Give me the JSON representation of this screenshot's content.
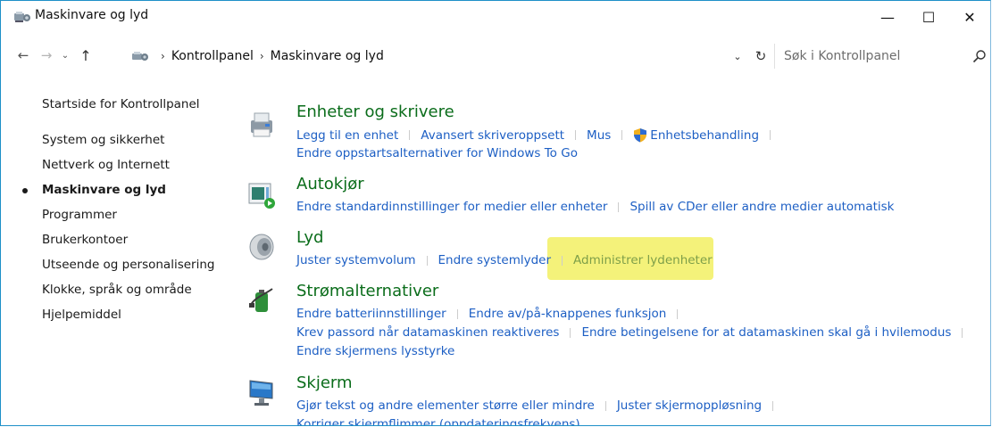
{
  "window": {
    "title": "Maskinvare og lyd",
    "minimize_glyph": "—",
    "maximize_glyph": "☐",
    "close_glyph": "✕"
  },
  "nav": {
    "back_glyph": "←",
    "forward_glyph": "→",
    "recent_glyph": "⌄",
    "up_glyph": "↑"
  },
  "address": {
    "breadcrumb": [
      "Kontrollpanel",
      "Maskinvare og lyd"
    ],
    "separator": "›",
    "dropdown_glyph": "⌄",
    "refresh_glyph": "↻"
  },
  "search": {
    "placeholder": "Søk i Kontrollpanel",
    "value": ""
  },
  "sidebar": {
    "items": [
      {
        "label": "Startside for Kontrollpanel",
        "current": false
      },
      {
        "label": "System og sikkerhet",
        "current": false
      },
      {
        "label": "Nettverk og Internett",
        "current": false
      },
      {
        "label": "Maskinvare og lyd",
        "current": true
      },
      {
        "label": "Programmer",
        "current": false
      },
      {
        "label": "Brukerkontoer",
        "current": false
      },
      {
        "label": "Utseende og personalisering",
        "current": false
      },
      {
        "label": "Klokke, språk og område",
        "current": false
      },
      {
        "label": "Hjelpemiddel",
        "current": false
      }
    ]
  },
  "categories": [
    {
      "title": "Enheter og skrivere",
      "icon": "printer-device-icon",
      "rows": [
        [
          "Legg til en enhet",
          "Avansert skriveroppsett",
          "Mus",
          "Enhetsbehandling"
        ],
        [
          "Endre oppstartsalternativer for Windows To Go"
        ]
      ]
    },
    {
      "title": "Autokjør",
      "icon": "autoplay-icon",
      "rows": [
        [
          "Endre standardinnstillinger for medier eller enheter",
          "Spill av CDer eller andre medier automatisk"
        ]
      ]
    },
    {
      "title": "Lyd",
      "icon": "speaker-icon",
      "rows": [
        [
          "Juster systemvolum",
          "Endre systemlyder",
          "Administrer lydenheter"
        ]
      ]
    },
    {
      "title": "Strømalternativer",
      "icon": "battery-power-icon",
      "rows": [
        [
          "Endre batteriinnstillinger",
          "Endre av/på-knappenes funksjon"
        ],
        [
          "Krev passord når datamaskinen reaktiveres",
          "Endre betingelsene for at datamaskinen skal gå i hvilemodus"
        ],
        [
          "Endre skjermens lysstyrke"
        ]
      ]
    },
    {
      "title": "Skjerm",
      "icon": "monitor-icon",
      "rows": [
        [
          "Gjør tekst og andre elementer større eller mindre",
          "Juster skjermoppløsning"
        ],
        [
          "Korriger skjermflimmer (oppdateringsfrekvens)"
        ]
      ]
    }
  ],
  "colors": {
    "category_title": "#0b6d1b",
    "link": "#1d5fc4",
    "highlight": "#f4f27a",
    "window_border": "#1e90c8"
  }
}
